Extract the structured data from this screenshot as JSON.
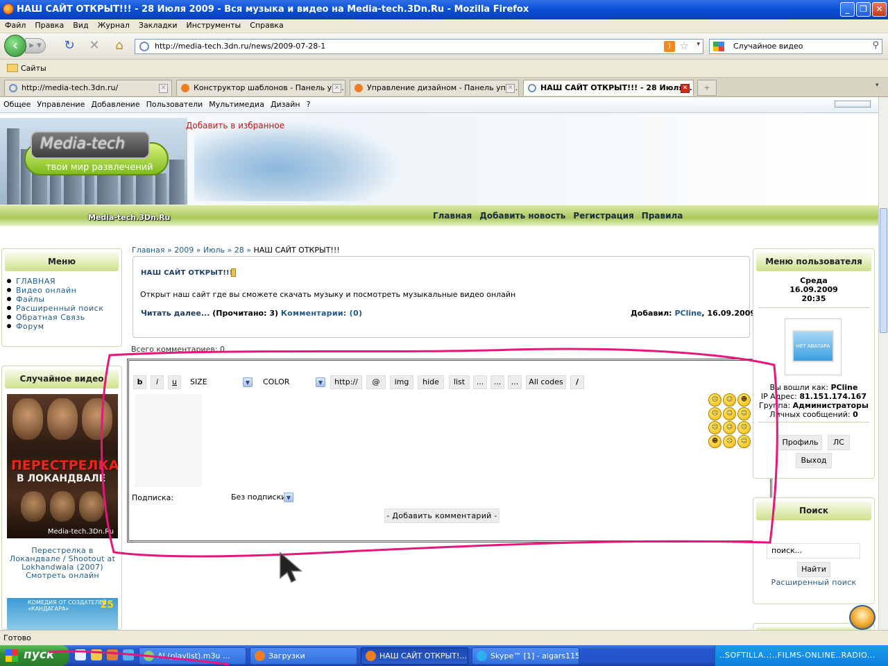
{
  "window": {
    "title": "НАШ САЙТ ОТКРЫТ!!! - 28 Июля 2009 - Вся музыка и видео на Media-tech.3Dn.Ru - Mozilla Firefox",
    "minimize": "_",
    "maximize": "❐",
    "close": "✕"
  },
  "menubar": [
    "Файл",
    "Правка",
    "Вид",
    "Журнал",
    "Закладки",
    "Инструменты",
    "Справка"
  ],
  "nav": {
    "url": "http://media-tech.3dn.ru/news/2009-07-28-1",
    "search_value": "Случайное видео"
  },
  "bookmarks": {
    "folder": "Сайты"
  },
  "tabs": [
    {
      "label": "http://media-tech.3dn.ru/",
      "active": false
    },
    {
      "label": "Конструктор шаблонов - Панель упр...",
      "active": false
    },
    {
      "label": "Управление дизайном - Панель упра...",
      "active": false
    },
    {
      "label": "НАШ САЙТ ОТКРЫТ!!! - 28 Июля ...",
      "active": true
    }
  ],
  "adminbar": [
    "Общее",
    "Управление",
    "Добавление",
    "Пользователи",
    "Мультимедиа",
    "Дизайн",
    "?"
  ],
  "site": {
    "logo_text": "Media-tech",
    "logo_sub": "твои мир развлечений",
    "add_fav": "Добавить в избранное",
    "watermark": "Media-tech.3Dn.Ru",
    "toplinks": [
      "Главная",
      "Добавить новость",
      "Регистрация",
      "Правила"
    ]
  },
  "menu": {
    "title": "Меню",
    "items": [
      "ГЛАВНАЯ",
      "Видео онлайн",
      "Файлы",
      "Расширенный поиск",
      "Обратная Связь",
      "Форум"
    ]
  },
  "random_video": {
    "title": "Случайное видео",
    "poster_title": "ПЕРЕСТРЕЛКА",
    "poster_sub": "В ЛОКАНДВАЛЕ",
    "poster_watermark": "Media-tech.3Dn.Ru",
    "caption": "Перестрелка в Локандвале / Shootout at Lokhandwala (2007) Смотреть онлайн",
    "poster2_badge": "25",
    "poster2_text": "КОМЕДИЯ ОТ СОЗДАТЕЛЕЙ «КАНДАГАРА»"
  },
  "breadcrumb": {
    "items": [
      "Главная",
      "2009",
      "Июль",
      "28"
    ],
    "separator": "»",
    "current": "НАШ САЙТ ОТКРЫТ!!!"
  },
  "news": {
    "title": "НАШ САЙТ ОТКРЫТ!!!",
    "body": "Открыт наш сайт где вы сможете скачать музыку и посмотреть музыкальные видео онлайн",
    "read_more": "Читать далее...",
    "read_count": "(Прочитано: 3)",
    "comments": "Комментарии: (0)",
    "added_by_label": "Добавил:",
    "author": "PCline",
    "date": ", 16.09.2009"
  },
  "comments": {
    "total": "Всего комментариев: 0",
    "toolbar": {
      "bold": "b",
      "italic": "i",
      "underline": "u",
      "size": "SIZE",
      "color": "COLOR",
      "url": "http://",
      "email": "@",
      "img": "img",
      "hide": "hide",
      "list": "list",
      "dots1": "...",
      "dots2": "...",
      "dots3": "...",
      "all_codes": "All codes",
      "slash": "/"
    },
    "subscription_label": "Подписка:",
    "subscription_value": "Без подписки",
    "submit": "- Добавить комментарий -"
  },
  "user": {
    "title": "Меню пользователя",
    "day": "Среда",
    "date": "16.09.2009",
    "time": "20:35",
    "avatar_text": "НЕТ АВАТАРА",
    "logged_as_label": "Вы вошли как:",
    "logged_as": "PCline",
    "ip_label": "IP Адрес:",
    "ip": "81.151.174.167",
    "group_label": "Группа:",
    "group": "Администраторы",
    "messages_label": "Личных сообщений:",
    "messages": "0",
    "profile": "Профиль",
    "pm": "ЛС",
    "logout": "Выход"
  },
  "search": {
    "title": "Поиск",
    "value": "поиск...",
    "button": "Найти",
    "advanced": "Расширенный поиск"
  },
  "status": "Готово",
  "taskbar": {
    "start": "пуск",
    "tasks": [
      {
        "label": "AI (playlist).m3u ...",
        "active": false
      },
      {
        "label": "Загрузки",
        "active": false
      },
      {
        "label": "НАШ САЙТ ОТКРЫТ!...",
        "active": true
      },
      {
        "label": "Skype™ [1] - aigars115",
        "active": false
      }
    ],
    "tray": "..SOFTILLA..:..FILMS-ONLINE..RADIO..."
  },
  "colors": {
    "annotation": "#e8157a",
    "link": "#1e5a8e",
    "accent_green": "#a9c85a",
    "fav_red": "#c81212"
  }
}
